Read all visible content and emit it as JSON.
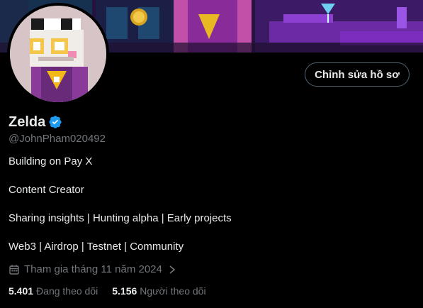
{
  "profile": {
    "display_name": "Zelda",
    "handle": "@JohnPham020492",
    "edit_label": "Chỉnh sửa hồ sơ",
    "bio": [
      "Building on Pay X",
      "Content Creator",
      "Sharing insights | Hunting alpha | Early projects",
      "Web3 | Airdrop | Testnet | Community"
    ],
    "joined": "Tham gia tháng 11 năm 2024",
    "following_count": "5.401",
    "following_label": "Đang theo dõi",
    "followers_count": "5.156",
    "followers_label": "Người theo dõi"
  },
  "icons": {
    "verified": "verified-badge-icon",
    "calendar": "calendar-icon",
    "chevron": "chevron-right-icon"
  },
  "colors": {
    "background": "#000000",
    "text": "#e7e9ea",
    "muted": "#71767b",
    "verified": "#1d9bf0",
    "button_border": "#536471"
  }
}
